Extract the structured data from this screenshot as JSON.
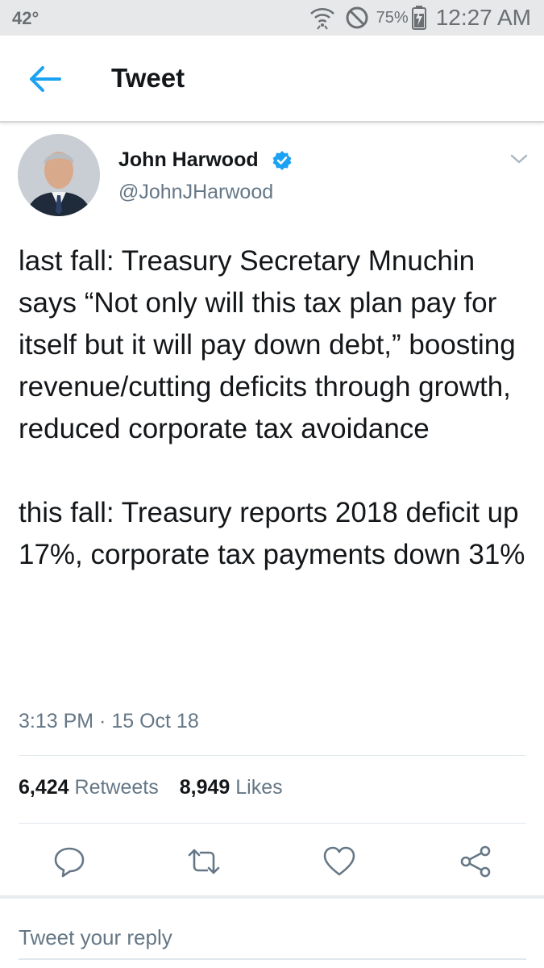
{
  "status_bar": {
    "temperature": "42°",
    "battery": "75%",
    "time": "12:27 AM"
  },
  "app_bar": {
    "title": "Tweet"
  },
  "tweet": {
    "author_name": "John Harwood",
    "author_handle": "@JohnJHarwood",
    "text": "last fall: Treasury Secretary Mnuchin says “Not only will this tax plan pay for itself but it will pay down debt,” boosting revenue/cutting deficits through growth, reduced corporate tax avoidance\n\nthis fall: Treasury reports 2018 deficit up 17%, corporate tax payments down 31%",
    "timestamp": "3:13 PM · 15 Oct 18",
    "retweets_count": "6,424",
    "retweets_label": "Retweets",
    "likes_count": "8,949",
    "likes_label": "Likes"
  },
  "reply": {
    "placeholder": "Tweet your reply"
  },
  "icons": {
    "back": "arrow-left-icon",
    "verified": "verified-badge-icon",
    "caret": "chevron-down-icon",
    "reply": "reply-icon",
    "retweet": "retweet-icon",
    "like": "heart-icon",
    "share": "share-icon"
  },
  "colors": {
    "accent": "#1da1f2",
    "text": "#14171a",
    "secondary": "#657786",
    "status_bar_bg": "#e7e8ea"
  }
}
